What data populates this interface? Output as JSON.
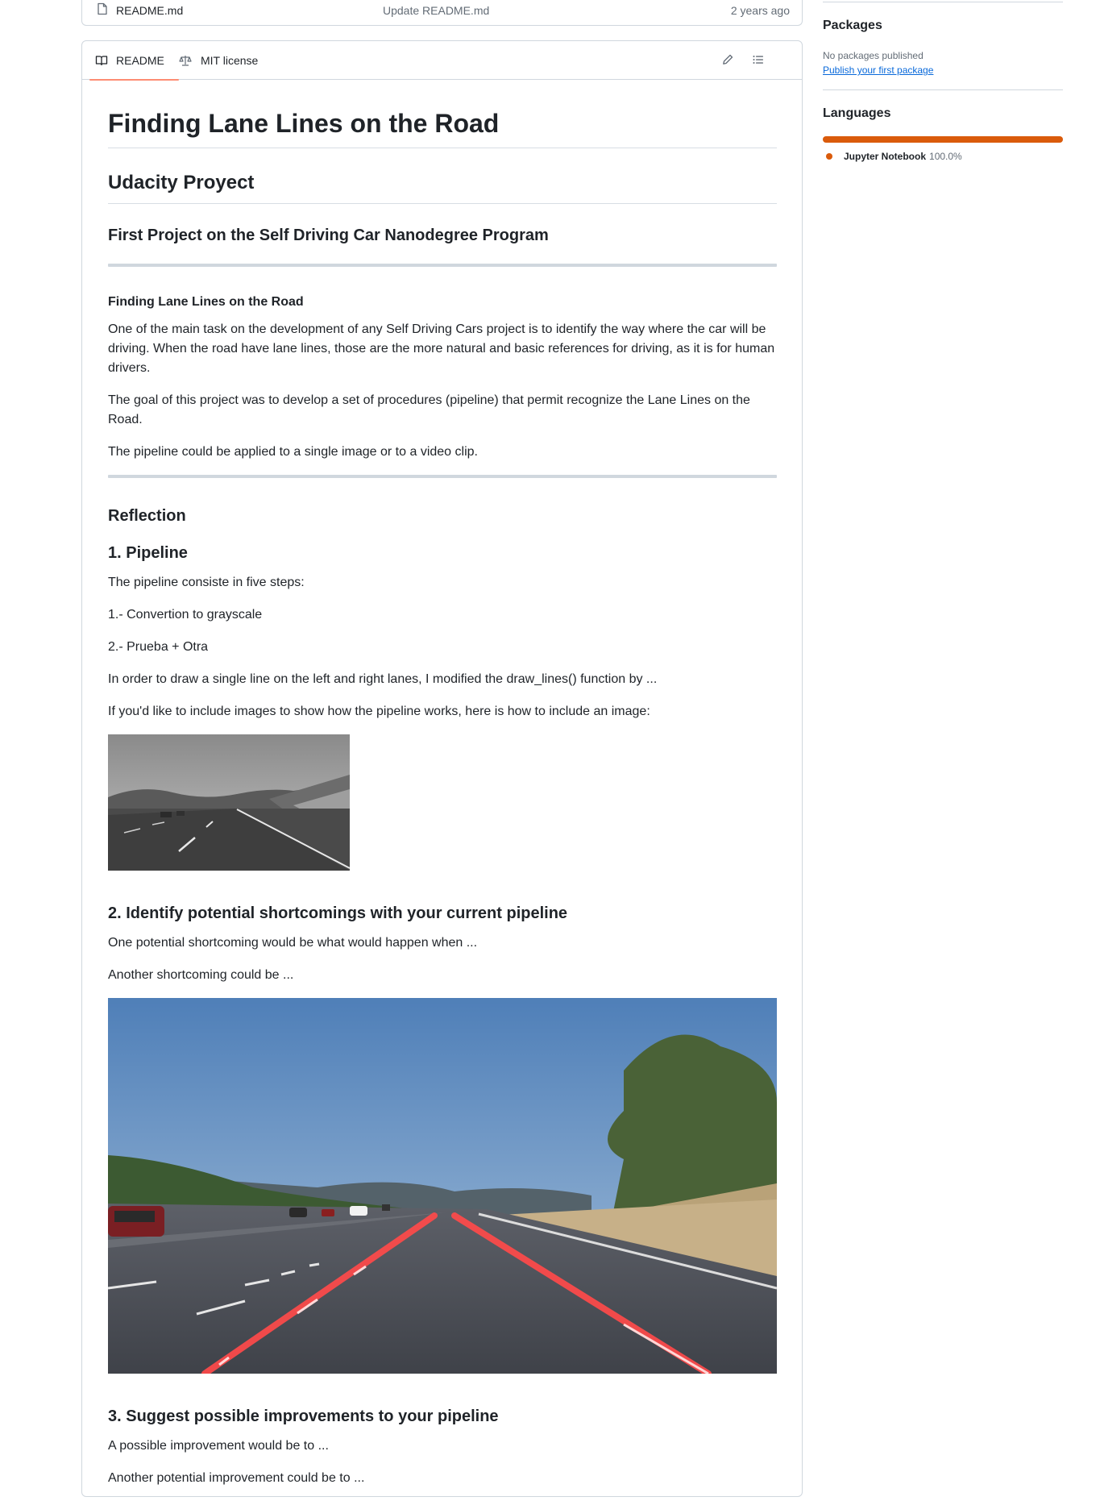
{
  "file_row": {
    "name": "README.md",
    "commit_message": "Update README.md",
    "age": "2 years ago"
  },
  "readme_tabs": {
    "readme": "README",
    "license": "MIT license",
    "icons": [
      "book-icon",
      "law-icon",
      "pencil-icon",
      "list-icon"
    ]
  },
  "readme": {
    "h1": "Finding Lane Lines on the Road",
    "h2": "Udacity Proyect",
    "h3_program": "First Project on the Self Driving Car Nanodegree Program",
    "h4_title": "Finding Lane Lines on the Road",
    "intro_p1": "One of the main task on the development of any Self Driving Cars project is to identify the way where the car will be driving. When the road have lane lines, those are the more natural and basic references for driving, as it is for human drivers.",
    "intro_p2": "The goal of this project was to develop a set of procedures (pipeline) that permit recognize the Lane Lines on the Road.",
    "intro_p3": "The pipeline could be applied to a single image or to a video clip.",
    "reflection": "Reflection",
    "section1_title": "1. Pipeline",
    "section1_p1": "The pipeline consiste in five steps:",
    "section1_p2": "1.- Convertion to grayscale",
    "section1_p3": "2.- Prueba + Otra",
    "section1_p4": "In order to draw a single line on the left and right lanes, I modified the draw_lines() function by ...",
    "section1_p5": "If you'd like to include images to show how the pipeline works, here is how to include an image:",
    "section2_title": "2. Identify potential shortcomings with your current pipeline",
    "section2_p1": "One potential shortcoming would be what would happen when ...",
    "section2_p2": "Another shortcoming could be ...",
    "section3_title": "3. Suggest possible improvements to your pipeline",
    "section3_p1": "A possible improvement would be to ...",
    "section3_p2": "Another potential improvement could be to ..."
  },
  "sidebar": {
    "packages_heading": "Packages",
    "packages_empty": "No packages published",
    "packages_link": "Publish your first package",
    "languages_heading": "Languages",
    "languages": [
      {
        "name": "Jupyter Notebook",
        "percent": "100.0%",
        "share": 1.0,
        "color": "#da5b0b"
      }
    ]
  },
  "colors": {
    "accent_tab": "#fd8c73",
    "link": "#0969da",
    "language_jupyter": "#da5b0b",
    "border": "#d0d7de"
  }
}
